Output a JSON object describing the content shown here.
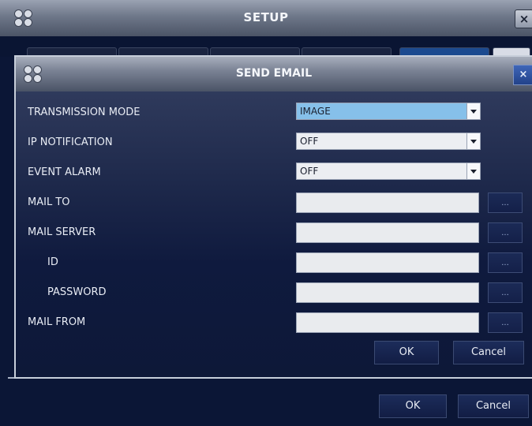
{
  "outer_window": {
    "title": "SETUP",
    "close_label": "×",
    "ok_label": "OK",
    "cancel_label": "Cancel"
  },
  "dialog": {
    "title": "SEND EMAIL",
    "close_label": "×",
    "fields": {
      "transmission_mode": {
        "label": "TRANSMISSION MODE",
        "value": "IMAGE"
      },
      "ip_notification": {
        "label": "IP NOTIFICATION",
        "value": "OFF"
      },
      "event_alarm": {
        "label": "EVENT ALARM",
        "value": "OFF"
      },
      "mail_to": {
        "label": "MAIL TO",
        "value": ""
      },
      "mail_server": {
        "label": "MAIL SERVER",
        "value": ""
      },
      "id": {
        "label": "ID",
        "value": ""
      },
      "password": {
        "label": "PASSWORD",
        "value": ""
      },
      "mail_from": {
        "label": "MAIL FROM",
        "value": ""
      }
    },
    "browse_label": "...",
    "ok_label": "OK",
    "cancel_label": "Cancel"
  },
  "colors": {
    "background": "#0d1a3a",
    "titlebar": "#6e7789",
    "selected_option": "#86c0ea"
  }
}
